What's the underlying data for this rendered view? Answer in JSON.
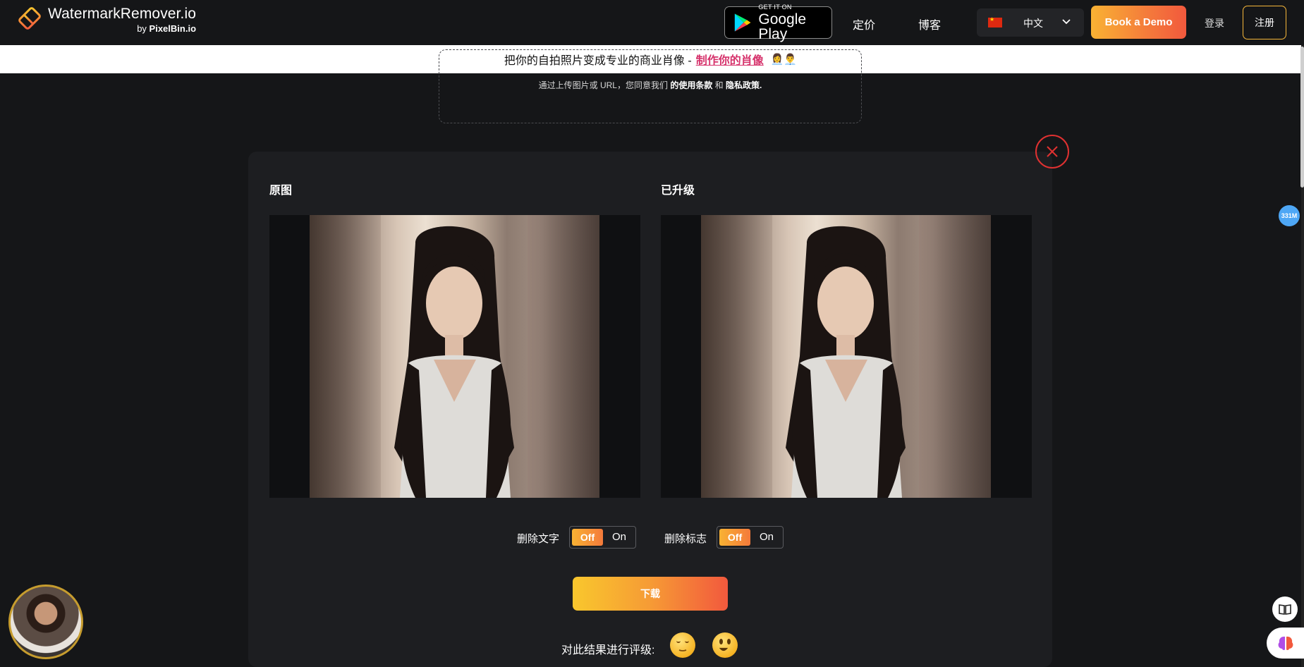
{
  "header": {
    "brand_title": "WatermarkRemover.io",
    "brand_sub_prefix": "by",
    "brand_sub_name": "PixelBin.io",
    "gplay_small": "GET IT ON",
    "gplay_big": "Google Play",
    "nav_pricing": "定价",
    "nav_blog": "博客",
    "lang_label": "中文",
    "demo_label": "Book a Demo",
    "login_label": "登录",
    "signup_label": "注册"
  },
  "banner": {
    "text": "把你的自拍照片变成专业的商业肖像 -",
    "link": "制作你的肖像",
    "emoji": "👩‍💼👨‍💼"
  },
  "upload": {
    "terms_prefix": "通过上传图片或 URL，您同意我们",
    "terms_link": "的使用条款",
    "terms_and": "和",
    "privacy_link": "隐私政策."
  },
  "result": {
    "original_title": "原图",
    "upgraded_title": "已升级",
    "remove_text_label": "删除文字",
    "remove_logo_label": "删除标志",
    "toggle_off": "Off",
    "toggle_on": "On",
    "download_label": "下载",
    "rate_label": "对此结果进行评级:"
  },
  "widgets": {
    "badge": "331M"
  },
  "colors": {
    "accent_orange": "#f47a3b",
    "accent_yellow": "#f9b233",
    "close_red": "#e03131",
    "banner_link": "#d6336c"
  }
}
